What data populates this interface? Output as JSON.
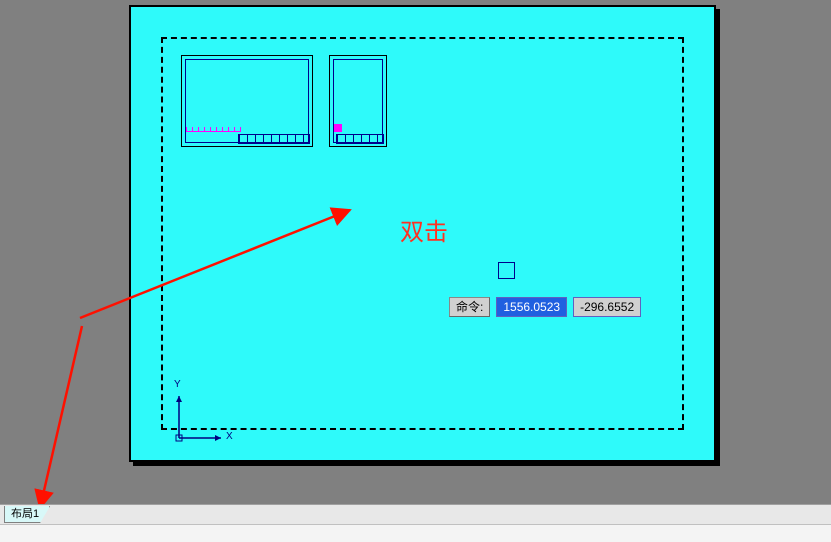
{
  "canvas": {
    "annotation_text": "双击",
    "cursor_box": true
  },
  "command_bar": {
    "label": "命令:",
    "value_x": "1556.0523",
    "value_y": "-296.6552"
  },
  "ucs": {
    "x_label": "X",
    "y_label": "Y"
  },
  "tabs": {
    "active": "布局1"
  },
  "colors": {
    "paper": "#2efafa",
    "desk": "#808080",
    "annotation": "#ff3020",
    "ucs": "#000080"
  }
}
